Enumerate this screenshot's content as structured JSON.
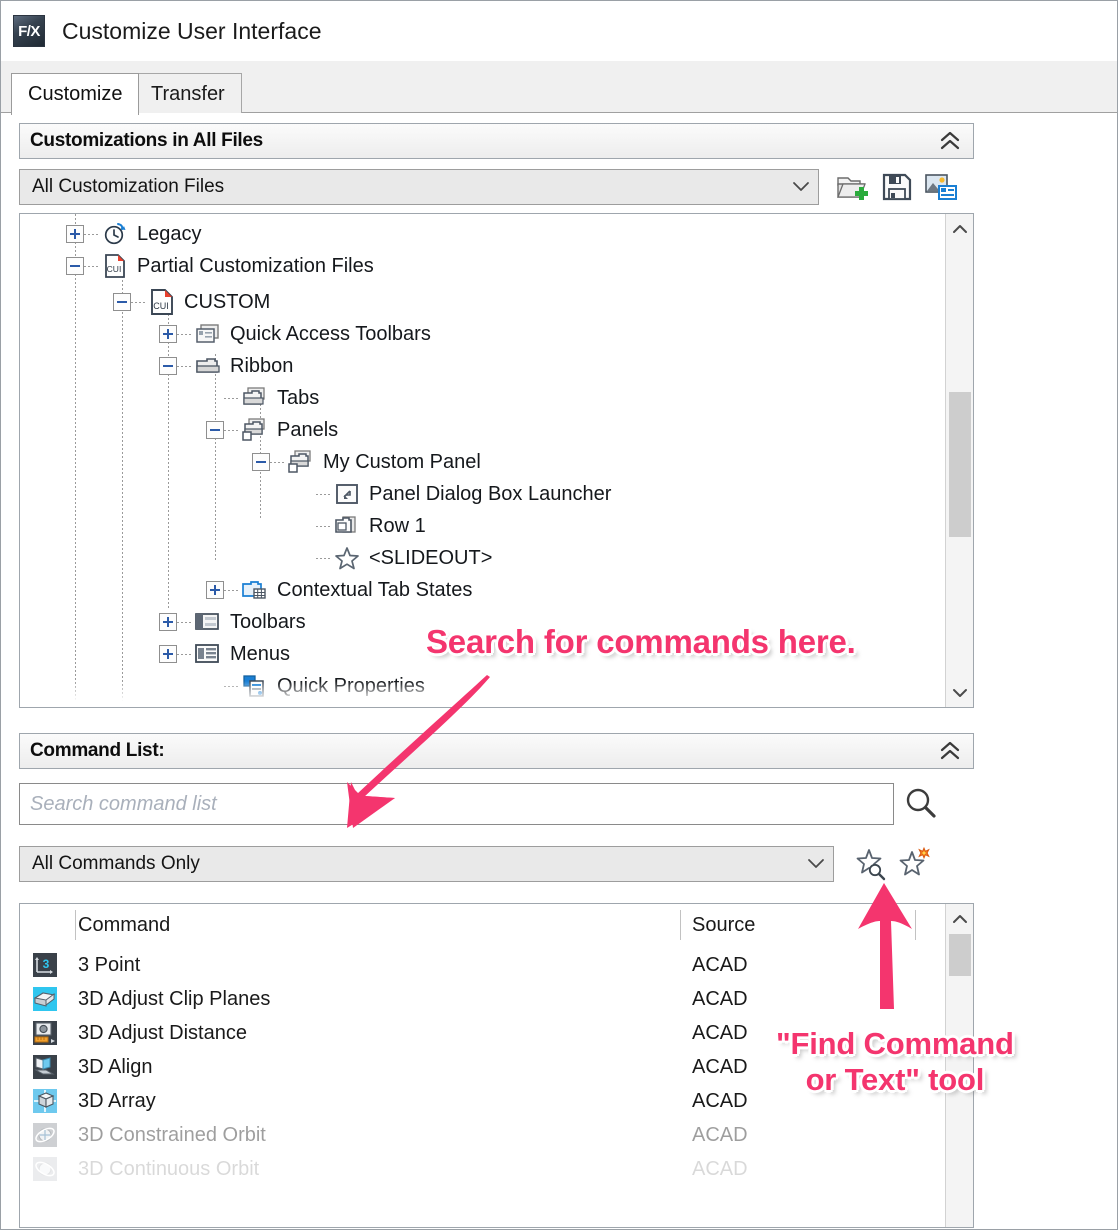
{
  "window": {
    "title": "Customize User Interface",
    "logo_text": "F/X",
    "logo_icon": "fx-logo-icon"
  },
  "tabs": [
    {
      "label": "Customize",
      "active": true
    },
    {
      "label": "Transfer",
      "active": false
    }
  ],
  "customizations_panel": {
    "header": "Customizations in All Files",
    "collapse_icon": "double-chevron-up-icon",
    "file_selector": {
      "value": "All Customization Files",
      "caret_icon": "chevron-down-icon"
    },
    "toolbar": [
      {
        "name": "load-partial-customization-file-button",
        "icon": "open-folder-plus-icon"
      },
      {
        "name": "save-customization-file-button",
        "icon": "floppy-disk-save-icon"
      },
      {
        "name": "replace-customization-file-button",
        "icon": "image-list-icon"
      }
    ],
    "tree": [
      {
        "label": "Legacy",
        "depth": 1,
        "expander": "plus",
        "icon": "clock-legacy-icon"
      },
      {
        "label": "Partial Customization Files",
        "depth": 1,
        "expander": "minus",
        "icon": "cui-file-icon"
      },
      {
        "label": "CUSTOM",
        "depth": 2,
        "expander": "minus",
        "icon": "cui-file-icon"
      },
      {
        "label": "Quick Access Toolbars",
        "depth": 3,
        "expander": "plus",
        "icon": "qat-toolbar-icon"
      },
      {
        "label": "Ribbon",
        "depth": 3,
        "expander": "minus",
        "icon": "ribbon-icon"
      },
      {
        "label": "Tabs",
        "depth": 4,
        "expander": "none",
        "icon": "ribbon-tabs-icon"
      },
      {
        "label": "Panels",
        "depth": 4,
        "expander": "minus",
        "icon": "ribbon-panels-icon"
      },
      {
        "label": "My Custom Panel",
        "depth": 5,
        "expander": "minus",
        "icon": "ribbon-panel-icon"
      },
      {
        "label": "Panel Dialog Box Launcher",
        "depth": 6,
        "expander": "none",
        "icon": "dialog-launcher-icon"
      },
      {
        "label": "Row 1",
        "depth": 6,
        "expander": "none",
        "icon": "panel-row-icon"
      },
      {
        "label": "<SLIDEOUT>",
        "depth": 6,
        "expander": "none",
        "icon": "star-outline-icon"
      },
      {
        "label": "Contextual Tab States",
        "depth": 3,
        "expander": "plus",
        "icon": "contextual-tab-icon"
      },
      {
        "label": "Toolbars",
        "depth": 2,
        "expander": "plus",
        "icon": "toolbars-icon"
      },
      {
        "label": "Menus",
        "depth": 2,
        "expander": "plus",
        "icon": "menus-icon"
      },
      {
        "label": "Quick Properties",
        "depth": 2,
        "expander": "none",
        "icon": "quick-properties-icon"
      }
    ],
    "scrollbar": {
      "up_icon": "chevron-up-icon",
      "down_icon": "chevron-down-icon"
    }
  },
  "command_list_panel": {
    "header": "Command List:",
    "collapse_icon": "double-chevron-up-icon",
    "search": {
      "placeholder": "Search command list",
      "value": "",
      "button_icon": "magnifier-icon"
    },
    "filter": {
      "value": "All Commands Only",
      "caret_icon": "chevron-down-icon"
    },
    "filter_buttons": [
      {
        "name": "find-command-or-text-button",
        "icon": "star-magnifier-icon"
      },
      {
        "name": "create-new-command-button",
        "icon": "star-new-icon"
      }
    ],
    "table": {
      "columns": [
        "Command",
        "Source"
      ],
      "rows": [
        {
          "command": "3 Point",
          "source": "ACAD",
          "icon": "three-point-icon",
          "faded": 0
        },
        {
          "command": "3D Adjust Clip Planes",
          "source": "ACAD",
          "icon": "adjust-clip-planes-icon",
          "faded": 0
        },
        {
          "command": "3D Adjust Distance",
          "source": "ACAD",
          "icon": "adjust-distance-icon",
          "faded": 0
        },
        {
          "command": "3D Align",
          "source": "ACAD",
          "icon": "align-3d-icon",
          "faded": 0
        },
        {
          "command": "3D Array",
          "source": "ACAD",
          "icon": "array-3d-icon",
          "faded": 0
        },
        {
          "command": "3D Constrained Orbit",
          "source": "ACAD",
          "icon": "constrained-orbit-icon",
          "faded": 1
        },
        {
          "command": "3D Continuous Orbit",
          "source": "ACAD",
          "icon": "continuous-orbit-icon",
          "faded": 2
        }
      ],
      "scrollbar": {
        "up_icon": "chevron-up-icon"
      }
    }
  },
  "annotations": [
    {
      "name": "search-commands-callout",
      "text": "Search for commands here.",
      "color": "#f4356e"
    },
    {
      "name": "find-command-tool-callout",
      "text": "\"Find Command\nor Text\" tool",
      "color": "#f4356e"
    }
  ]
}
